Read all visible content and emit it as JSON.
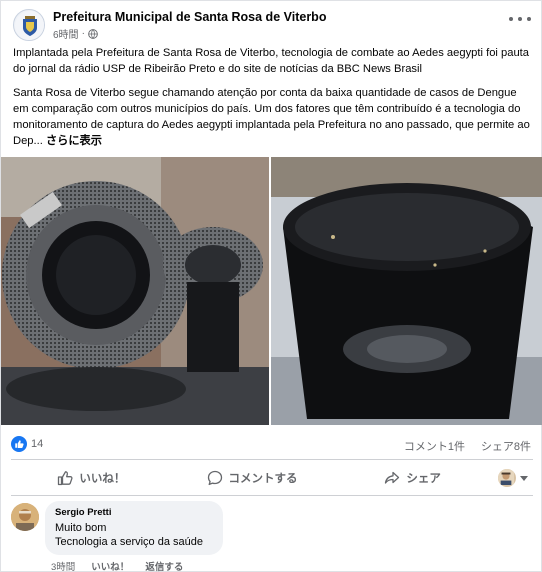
{
  "post": {
    "page_name": "Prefeitura Municipal de Santa Rosa de Viterbo",
    "time": "6時間",
    "paragraphs": [
      "Implantada pela Prefeitura de Santa Rosa de Viterbo, tecnologia de combate ao Aedes aegypti foi pauta do jornal da rádio USP de Ribeirão Preto e do site de notícias da BBC News Brasil",
      "Santa Rosa de Viterbo segue chamando atenção por conta da baixa quantidade de casos de Dengue em comparação com outros municípios do país. Um dos fatores que têm contribuído é a tecnologia do monitoramento de captura do Aedes aegypti implantada pela Prefeitura no ano passado, que permite ao Dep..."
    ],
    "see_more": "さらに表示"
  },
  "stats": {
    "like_count": "14",
    "comment_count": "コメント1件",
    "share_count": "シェア8件"
  },
  "actions": {
    "like": "いいね！",
    "comment": "コメントする",
    "share": "シェア"
  },
  "comment": {
    "author": "Sergio Pretti",
    "line1": "Muito bom",
    "line2": "Tecnologia a serviço da saúde",
    "time": "3時間",
    "like": "いいね！",
    "reply": "返信する"
  },
  "icons": {
    "globe": "globe-icon",
    "more": "more-options-icon",
    "like": "thumbs-up-icon",
    "comment": "comment-bubble-icon",
    "share": "share-arrow-icon"
  },
  "colors": {
    "brand_blue": "#1877f2",
    "secondary_text": "#65676b",
    "comment_bg": "#f0f2f5"
  }
}
